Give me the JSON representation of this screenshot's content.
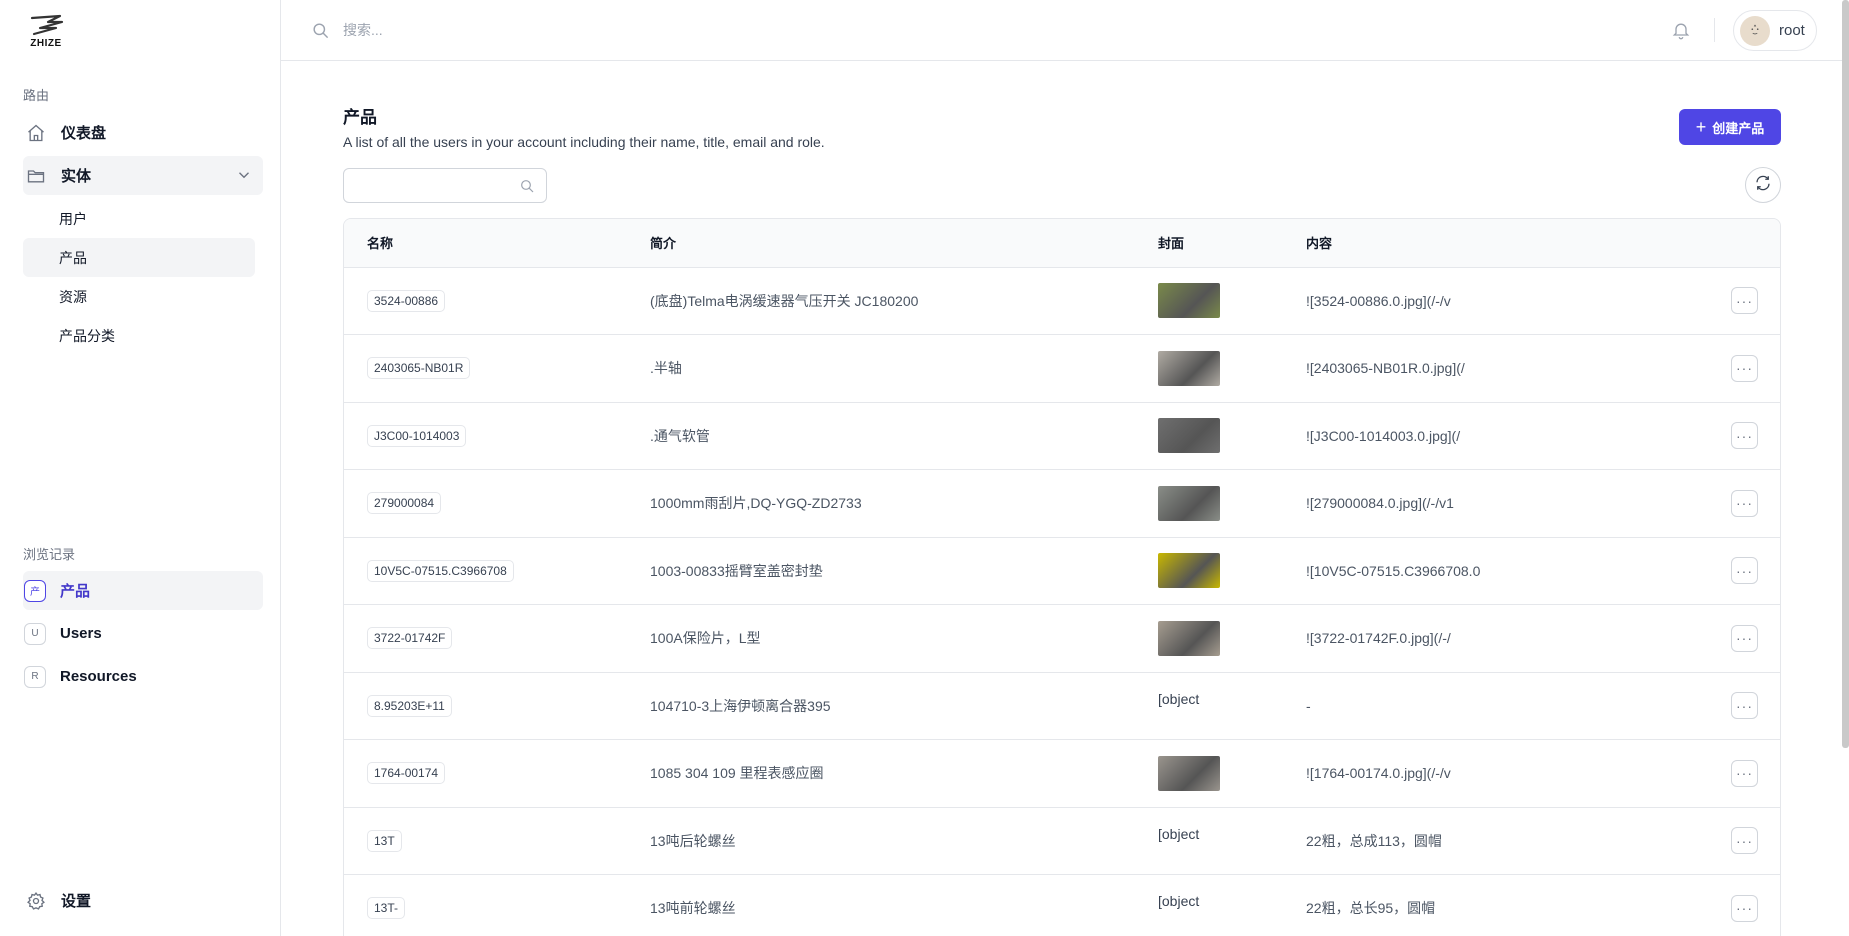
{
  "logo": {
    "text": "ZHIZE"
  },
  "sidebar": {
    "routes_label": "路由",
    "dashboard": "仪表盘",
    "entities": "实体",
    "sub_items": [
      "用户",
      "产品",
      "资源",
      "产品分类"
    ],
    "recent_label": "浏览记录",
    "recent": [
      {
        "letter": "产",
        "label": "产品"
      },
      {
        "letter": "U",
        "label": "Users"
      },
      {
        "letter": "R",
        "label": "Resources"
      }
    ],
    "settings": "设置"
  },
  "topbar": {
    "search_placeholder": "搜索...",
    "user_name": "root"
  },
  "page": {
    "title": "产品",
    "description": "A list of all the users in your account including their name, title, email and role.",
    "create_button": "创建产品"
  },
  "table": {
    "headers": [
      "名称",
      "简介",
      "封面",
      "内容"
    ],
    "rows": [
      {
        "name": "3524-00886",
        "desc": "(底盘)Telma电涡缓速器气压开关 JC180200",
        "cover": "img",
        "cover_color": "#7a8a4a",
        "content": "![3524-00886.0.jpg](/-/v"
      },
      {
        "name": "2403065-NB01R",
        "desc": ".半轴",
        "cover": "img",
        "cover_color": "#b0aba3",
        "content": "![2403065-NB01R.0.jpg](/"
      },
      {
        "name": "J3C00-1014003",
        "desc": ".通气软管",
        "cover": "img",
        "cover_color": "#6f6f6f",
        "content": "![J3C00-1014003.0.jpg](/"
      },
      {
        "name": "279000084",
        "desc": "1000mm雨刮片,DQ-YGQ-ZD2733",
        "cover": "img",
        "cover_color": "#8a8e88",
        "content": "![279000084.0.jpg](/-/v1"
      },
      {
        "name": "10V5C-07515.C3966708",
        "desc": "1003-00833摇臂室盖密封垫",
        "cover": "img",
        "cover_color": "#c9b800",
        "content": "![10V5C-07515.C3966708.0"
      },
      {
        "name": "3722-01742F",
        "desc": "100A保险片，L型",
        "cover": "img",
        "cover_color": "#a69d90",
        "content": "![3722-01742F.0.jpg](/-/"
      },
      {
        "name": "8.95203E+11",
        "desc": "104710-3上海伊顿离合器395",
        "cover": "broken",
        "cover_text": "[object",
        "content": "-"
      },
      {
        "name": "1764-00174",
        "desc": "1085 304 109 里程表感应圈",
        "cover": "img",
        "cover_color": "#9a958e",
        "content": "![1764-00174.0.jpg](/-/v"
      },
      {
        "name": "13T",
        "desc": "13吨后轮螺丝",
        "cover": "broken",
        "cover_text": "[object",
        "content": "22粗，总成113，圆帽"
      },
      {
        "name": "13T-",
        "desc": "13吨前轮螺丝",
        "cover": "broken",
        "cover_text": "[object",
        "content": "22粗，总长95，圆帽"
      }
    ]
  },
  "colors": {
    "accent": "#4f46e5",
    "border": "#e5e7eb"
  }
}
